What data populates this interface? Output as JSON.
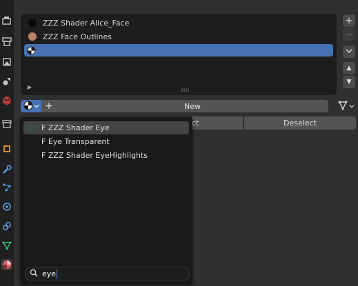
{
  "material_slots": [
    {
      "label": "ZZZ Shader Alice_Face",
      "swatch": "#0a0a0a",
      "selected": false
    },
    {
      "label": "ZZZ Face Outlines",
      "swatch": "#b9826a",
      "selected": false
    },
    {
      "label": "",
      "swatch": "sphere",
      "selected": true
    }
  ],
  "side_buttons": {
    "add": "+",
    "remove": "−",
    "menu": "⌄",
    "up": "▲",
    "down": "▼"
  },
  "toolbar": {
    "plus": "+",
    "new_label": "New"
  },
  "select_row": {
    "select_label": "ct",
    "deselect_label": "Deselect"
  },
  "dropdown": {
    "items": [
      {
        "label": "F ZZZ Shader Eye",
        "highlighted": true
      },
      {
        "label": "F Eye Transparent",
        "highlighted": false
      },
      {
        "label": "F ZZZ Shader EyeHighlights",
        "highlighted": false
      }
    ],
    "search_value": "eye"
  },
  "colors": {
    "accent": "#4772b3",
    "panel": "#303030",
    "list_bg": "#1d1d1d",
    "tab_bg": "#1f1f1f"
  }
}
